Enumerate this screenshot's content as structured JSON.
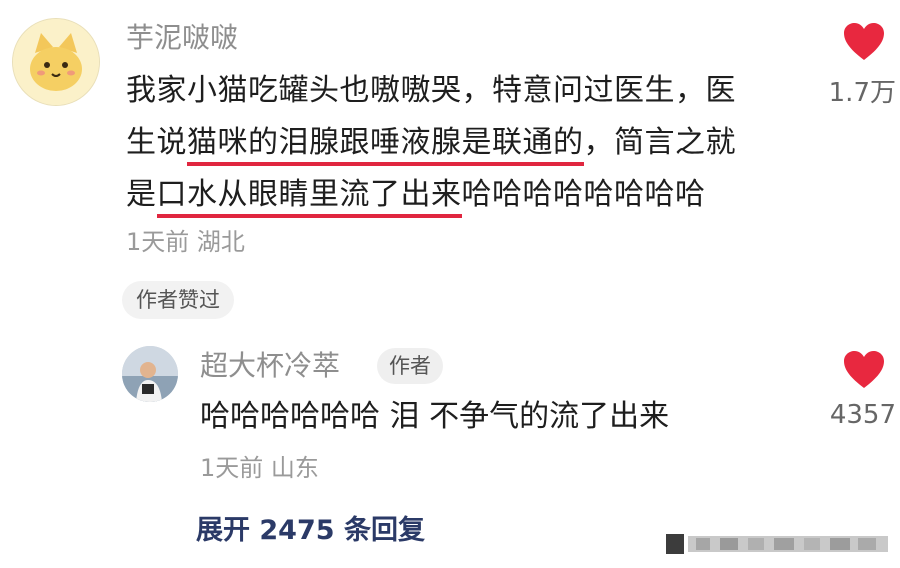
{
  "comment": {
    "username": "芋泥啵啵",
    "lines": [
      "我家小猫吃罐头也嗷嗷哭，特意问过医生，医",
      "猫咪的泪腺跟唾液腺是联通的",
      "，简言之就",
      "口水从眼睛里流了出来",
      "哈哈哈哈哈哈哈哈"
    ],
    "line2_prefix": "生说",
    "line3_prefix": "是",
    "time": "1天前",
    "location": "湖北",
    "author_liked": "作者赞过",
    "like_count": "1.7万"
  },
  "reply": {
    "username": "超大杯冷萃",
    "author_tag": "作者",
    "text": "哈哈哈哈哈哈 泪 不争气的流了出来",
    "time": "1天前",
    "location": "山东",
    "like_count": "4357"
  },
  "expand_label": "展开 2475 条回复",
  "colors": {
    "heart": "#e8283f",
    "highlight_underline": "#e0263f",
    "expand_text": "#2b3a67",
    "meta_text": "#9a9a9a"
  },
  "icons": {
    "like": "heart-icon"
  }
}
